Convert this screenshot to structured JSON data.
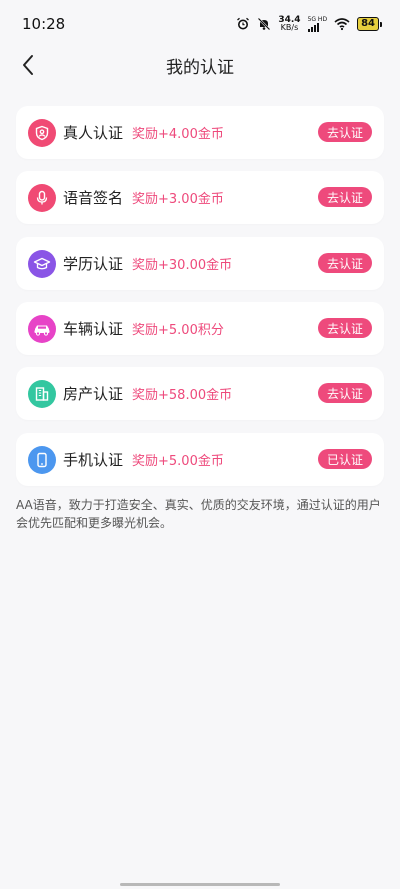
{
  "status_bar": {
    "time": "10:28",
    "net_speed_value": "34.4",
    "net_speed_unit": "KB/s",
    "network_type": "5G HD",
    "battery": "84"
  },
  "header": {
    "title": "我的认证",
    "back_icon": "chevron-left-icon"
  },
  "certifications": [
    {
      "name": "真人认证",
      "reward": "奖励+4.00金币",
      "action": "去认证",
      "icon": "person-shield-icon",
      "color": "#f04a74"
    },
    {
      "name": "语音签名",
      "reward": "奖励+3.00金币",
      "action": "去认证",
      "icon": "microphone-icon",
      "color": "#f04a74"
    },
    {
      "name": "学历认证",
      "reward": "奖励+30.00金币",
      "action": "去认证",
      "icon": "graduation-cap-icon",
      "color": "#8a55e6"
    },
    {
      "name": "车辆认证",
      "reward": "奖励+5.00积分",
      "action": "去认证",
      "icon": "car-icon",
      "color": "#e743c7"
    },
    {
      "name": "房产认证",
      "reward": "奖励+58.00金币",
      "action": "去认证",
      "icon": "building-icon",
      "color": "#33c7a0"
    },
    {
      "name": "手机认证",
      "reward": "奖励+5.00金币",
      "action": "已认证",
      "icon": "phone-icon",
      "color": "#4c97ef"
    }
  ],
  "footer_note": "AA语音，致力于打造安全、真实、优质的交友环境，通过认证的用户会优先匹配和更多曝光机会。",
  "colors": {
    "accent": "#ee4a7c",
    "background": "#f7f7f9"
  }
}
